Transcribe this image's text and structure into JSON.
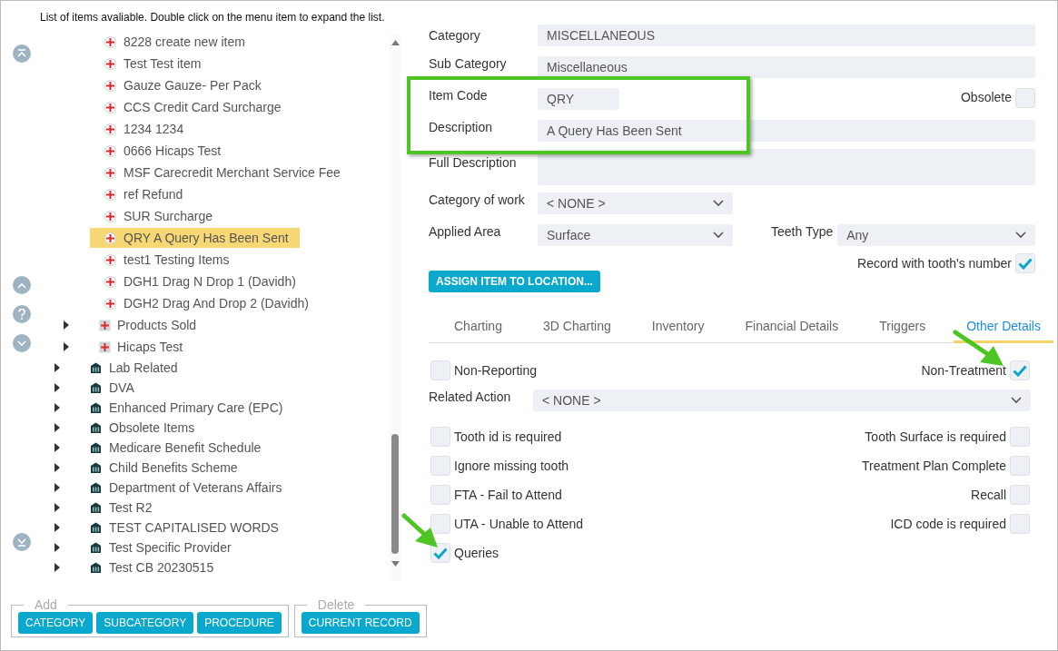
{
  "hint": "List of items avaliable. Double click on the menu item to expand the list.",
  "tree": {
    "procedures": [
      {
        "label": "8228 create new item",
        "selected": false
      },
      {
        "label": "Test Test item",
        "selected": false
      },
      {
        "label": "Gauze Gauze- Per Pack",
        "selected": false
      },
      {
        "label": "CCS Credit Card Surcharge",
        "selected": false
      },
      {
        "label": "1234 1234",
        "selected": false
      },
      {
        "label": "0666 Hicaps Test",
        "selected": false
      },
      {
        "label": "MSF Carecredit Merchant Service Fee",
        "selected": false
      },
      {
        "label": "ref Refund",
        "selected": false
      },
      {
        "label": "SUR Surcharge",
        "selected": false
      },
      {
        "label": "QRY A Query Has Been Sent",
        "selected": true
      },
      {
        "label": "test1 Testing Items",
        "selected": false
      },
      {
        "label": "DGH1 Drag N Drop 1 (Davidh)",
        "selected": false
      },
      {
        "label": "DGH2 Drag And Drop 2 (Davidh)",
        "selected": false
      }
    ],
    "subcategories": [
      {
        "label": "Products Sold",
        "expanded": false
      },
      {
        "label": "Hicaps Test",
        "expanded": false
      }
    ],
    "categories": [
      {
        "label": "Lab Related",
        "expanded": false
      },
      {
        "label": "DVA",
        "expanded": false
      },
      {
        "label": "Enhanced Primary Care (EPC)",
        "expanded": false
      },
      {
        "label": "Obsolete Items",
        "expanded": false
      },
      {
        "label": "Medicare Benefit Schedule",
        "expanded": false
      },
      {
        "label": "Child Benefits Scheme",
        "expanded": false
      },
      {
        "label": "Department of Veterans Affairs",
        "expanded": false
      },
      {
        "label": "Test R2",
        "expanded": false
      },
      {
        "label": "TEST CAPITALISED WORDS",
        "expanded": false
      },
      {
        "label": "Test Specific Provider",
        "expanded": false
      },
      {
        "label": "Test CB 20230515",
        "expanded": false
      }
    ]
  },
  "add_group": {
    "legend": "Add",
    "buttons": [
      "CATEGORY",
      "SUBCATEGORY",
      "PROCEDURE"
    ]
  },
  "delete_group": {
    "legend": "Delete",
    "buttons": [
      "CURRENT RECORD"
    ]
  },
  "form": {
    "category": {
      "label": "Category",
      "value": "MISCELLANEOUS"
    },
    "sub_category": {
      "label": "Sub Category",
      "value": "Miscellaneous"
    },
    "item_code": {
      "label": "Item Code",
      "value": "QRY"
    },
    "obsolete": {
      "label": "Obsolete",
      "checked": false
    },
    "description": {
      "label": "Description",
      "value": "A Query Has Been Sent"
    },
    "full_description": {
      "label": "Full Description"
    },
    "category_of_work": {
      "label": "Category of work",
      "value": "< NONE >"
    },
    "applied_area": {
      "label": "Applied Area",
      "value": "Surface"
    },
    "teeth_type": {
      "label": "Teeth Type",
      "value": "Any"
    },
    "record_with_tooth": {
      "label": "Record with tooth's number",
      "checked": true
    },
    "assign_button": "ASSIGN ITEM TO LOCATION..."
  },
  "tabs": [
    {
      "label": "Charting",
      "selected": false
    },
    {
      "label": "3D Charting",
      "selected": false
    },
    {
      "label": "Inventory",
      "selected": false
    },
    {
      "label": "Financial Details",
      "selected": false
    },
    {
      "label": "Triggers",
      "selected": false
    },
    {
      "label": "Other Details",
      "selected": true
    }
  ],
  "other_details": {
    "non_reporting": {
      "label": "Non-Reporting",
      "checked": false
    },
    "non_treatment": {
      "label": "Non-Treatment",
      "checked": true
    },
    "related_action": {
      "label": "Related Action",
      "value": "< NONE >"
    },
    "rows": [
      [
        {
          "label": "Tooth id is required",
          "checked": false
        },
        {
          "label": "Tooth Surface is required",
          "checked": false
        }
      ],
      [
        {
          "label": "Ignore missing tooth",
          "checked": false
        },
        {
          "label": "Treatment Plan Complete",
          "checked": false
        }
      ],
      [
        {
          "label": "FTA - Fail to Attend",
          "checked": false
        },
        {
          "label": "Recall",
          "checked": false
        }
      ],
      [
        {
          "label": "UTA - Unable to Attend",
          "checked": false
        },
        {
          "label": "ICD code is required",
          "checked": false
        }
      ]
    ],
    "queries": {
      "label": "Queries",
      "checked": true
    }
  }
}
